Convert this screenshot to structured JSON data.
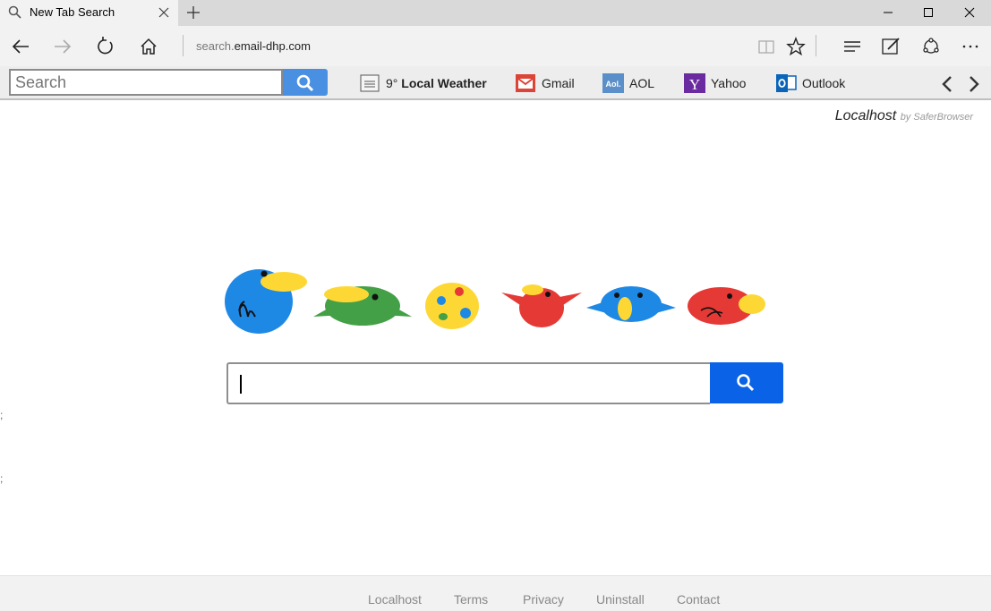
{
  "tab": {
    "title": "New Tab Search"
  },
  "address": {
    "prefix": "search.",
    "domain": "email-dhp.com"
  },
  "toolbar": {
    "search_placeholder": "Search",
    "weather_temp": "9°",
    "weather_label": "Local Weather",
    "links": [
      "Gmail",
      "AOL",
      "Yahoo",
      "Outlook"
    ],
    "aol_icon_text": "Aol."
  },
  "brand": {
    "name": "Localhost",
    "by": "by SaferBrowser"
  },
  "semicolons": [
    ";",
    ";"
  ],
  "footer": {
    "links": [
      "Localhost",
      "Terms",
      "Privacy",
      "Uninstall",
      "Contact"
    ]
  },
  "colors": {
    "toolbar_search_btn": "#4a90e2",
    "main_search_btn": "#0a63e6"
  }
}
